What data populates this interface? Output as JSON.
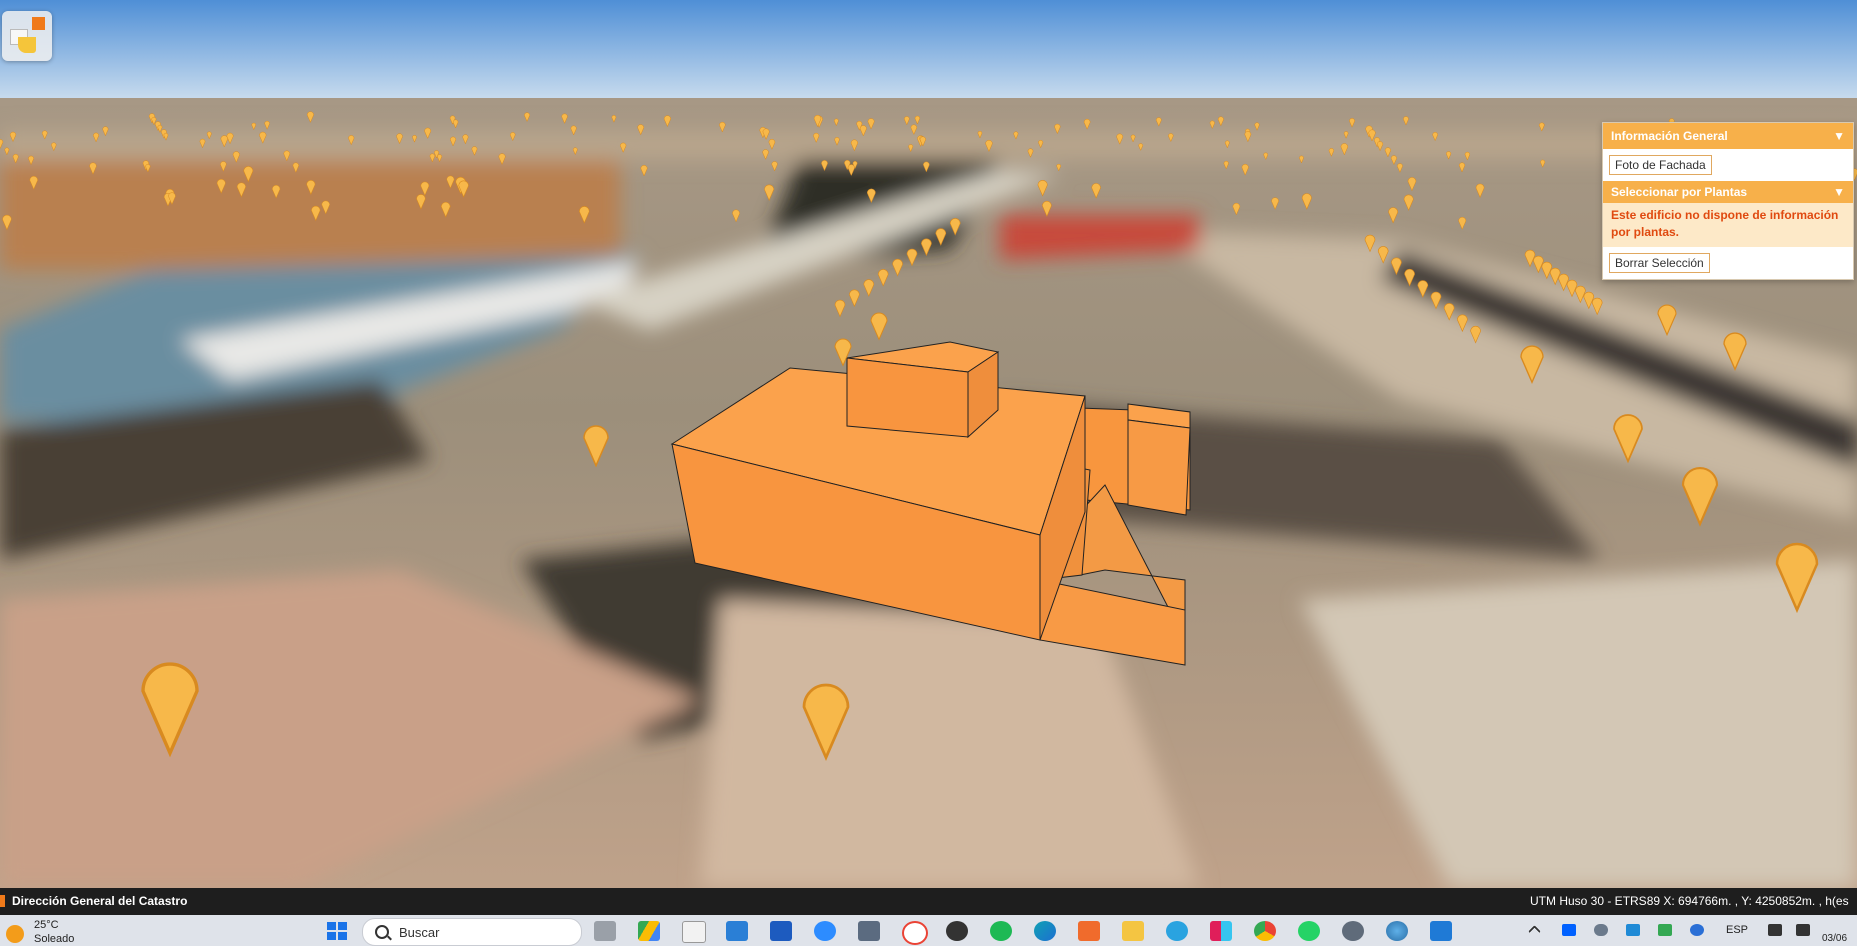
{
  "info_panel": {
    "header": "Información General",
    "header_arrow": "▼",
    "facade_button": "Foto de Fachada",
    "floors_header": "Seleccionar por Plantas",
    "floors_arrow": "▼",
    "floors_message": "Este edificio no dispone de información por plantas.",
    "clear_button": "Borrar Selección"
  },
  "status_bar": {
    "title": "Dirección General del Catastro",
    "coordinates": "UTM Huso 30 - ETRS89    X: 694766m. , Y: 4250852m. , h(es"
  },
  "taskbar": {
    "weather_temp": "25°C",
    "weather_condition": "Soleado",
    "search_placeholder": "Buscar",
    "language": "ESP",
    "date_partial": "03/06"
  },
  "colors": {
    "accent": "#f7b04a",
    "building": "#ffa04a",
    "marker": "#f7b84a",
    "message_text": "#e04a10"
  },
  "icons": [
    "logo-icon",
    "windows-start-icon",
    "search-icon",
    "task-view-icon",
    "drive-icon",
    "file-icon",
    "store-icon",
    "word-icon",
    "zoom-icon",
    "calculator-icon",
    "maps-icon",
    "obs-icon",
    "spotify-icon",
    "edge-icon",
    "sublime-icon",
    "folder-icon",
    "telegram-icon",
    "slack-icon",
    "chrome-icon",
    "whatsapp-icon",
    "settings-icon",
    "earth-icon",
    "app-icon"
  ]
}
